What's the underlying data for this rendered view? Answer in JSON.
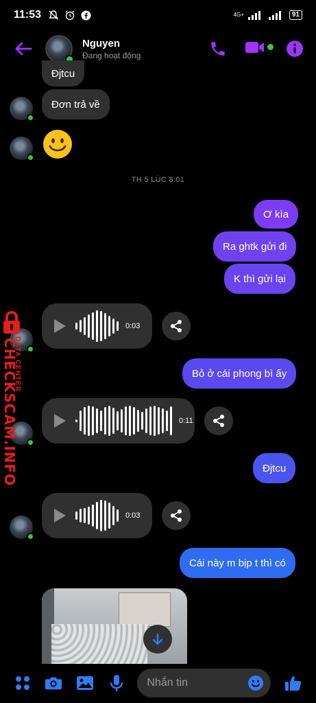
{
  "status_bar": {
    "time": "11:53",
    "network": "4G+",
    "battery": "91"
  },
  "header": {
    "contact_name": "Nguyen",
    "contact_status": "Đang hoạt động"
  },
  "messages": {
    "m1": "Đjtcu",
    "m2": "Đơn trả về",
    "m3": "🙂",
    "timestamp": "TH 5 LÚC 8:01",
    "m4": "Ơ kìa",
    "m5": "Ra ghtk gửi đi",
    "m6": "K thì gửi lại",
    "voice1_duration": "0:03",
    "m7": "Bỏ ở cái phong bì ấy",
    "voice2_duration": "0:11",
    "m8": "Đjtcu",
    "voice3_duration": "0:03",
    "m9": "Cái này m bịp t thì có"
  },
  "composer": {
    "placeholder": "Nhắn tin"
  },
  "watermark": {
    "line1": "DATA CENTER",
    "line2": "CHECKSCAM.INFO"
  },
  "colors": {
    "accent": "#a033ff",
    "outgoing_purple": "#7a3ff0",
    "outgoing_blue": "#2f6cf0",
    "incoming": "#303030",
    "online": "#31c84a",
    "watermark_red": "#e51d1d"
  }
}
